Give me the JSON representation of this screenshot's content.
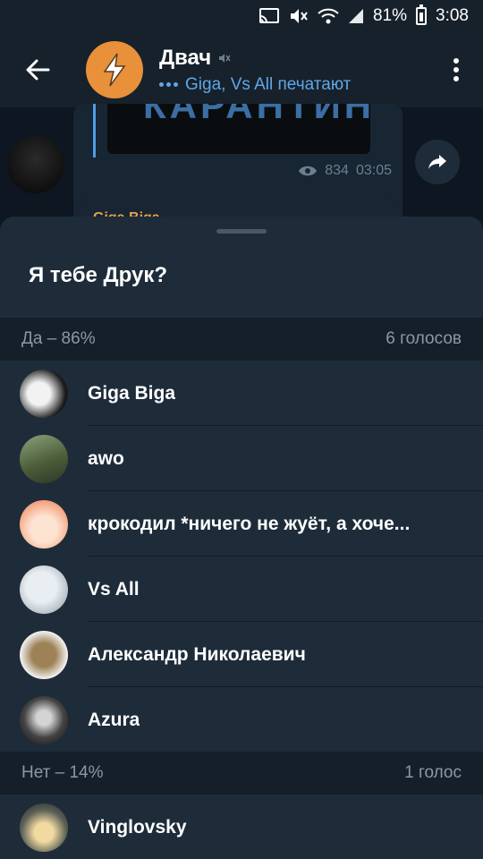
{
  "status_bar": {
    "battery": "81%",
    "time": "3:08"
  },
  "header": {
    "title": "Двач",
    "subtitle": "Giga, Vs All печатают"
  },
  "message": {
    "image_text": "КАРАНТИН",
    "views": "834",
    "time": "03:05",
    "next_sender": "Giga Biga"
  },
  "poll": {
    "question": "Я тебе Друк?",
    "options": [
      {
        "label": "Да – 86%",
        "count": "6 голосов",
        "voters": [
          "Giga Biga",
          "awo",
          "крокодил *ничего не жуёт, а хоче...",
          "Vs All",
          "Александр Николаевич",
          "Azura"
        ]
      },
      {
        "label": "Нет – 14%",
        "count": "1 голос",
        "voters": [
          "Vinglovsky"
        ]
      }
    ]
  },
  "colors": {
    "accent": "#5fa7e8",
    "sheet_bg": "#1e2c3a",
    "section_bg": "#151f29",
    "header_bg": "#17212b",
    "channel_avatar": "#e8903a"
  }
}
